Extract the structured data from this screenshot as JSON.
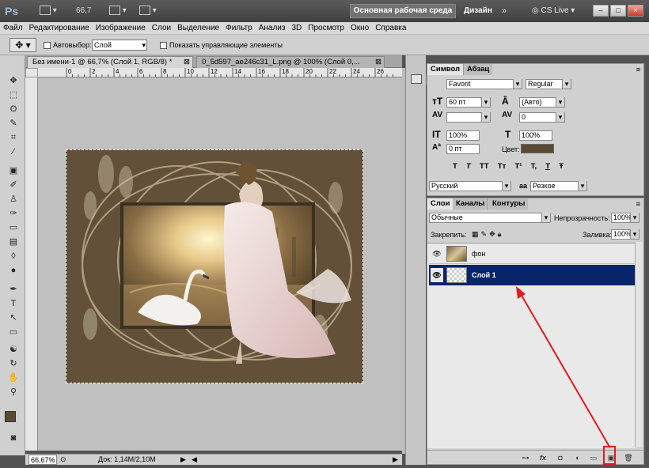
{
  "app": {
    "logo": "Ps",
    "zoom": "66,7",
    "workspace_button": "Основная рабочая среда",
    "design_label": "Дизайн",
    "more_label": "»",
    "cslive_label": "CS Live",
    "window_buttons": [
      "–",
      "□",
      "×"
    ]
  },
  "menu": [
    "Файл",
    "Редактирование",
    "Изображение",
    "Слои",
    "Выделение",
    "Фильтр",
    "Анализ",
    "3D",
    "Просмотр",
    "Окно",
    "Справка"
  ],
  "options": {
    "autoselect_label": "Автовыбор:",
    "autoselect_value": "Слой",
    "show_controls_label": "Показать управляющие элементы"
  },
  "tabs": [
    {
      "label": "Без имени-1 @ 66,7% (Слой 1, RGB/8) *",
      "active": true
    },
    {
      "label": "0_5d597_ae246c31_L.png @ 100% (Слой 0,...",
      "active": false
    }
  ],
  "ruler_numbers": [
    "0",
    "2",
    "4",
    "6",
    "8",
    "10",
    "12",
    "14",
    "16",
    "18",
    "20",
    "22",
    "24",
    "26"
  ],
  "status": {
    "zoom": "66,67%",
    "doc_info": "Док: 1,14M/2,10M"
  },
  "character": {
    "tabs": [
      "Символ",
      "Абзац"
    ],
    "font_family": "Favorit",
    "font_style": "Regular",
    "font_size": "60 пт",
    "leading": "(Авто)",
    "kerning": "",
    "tracking": "0",
    "vertical_scale": "100%",
    "horizontal_scale": "100%",
    "baseline_shift": "0 пт",
    "color_label": "Цвет:",
    "color_value": "#5a4a30",
    "style_buttons": [
      "T",
      "T",
      "TT",
      "Tт",
      "T¹",
      "T,",
      "T",
      "Ŧ"
    ],
    "language": "Русский",
    "aa_label": "aa",
    "antialias": "Резкое"
  },
  "layers": {
    "tabs": [
      "Слои",
      "Каналы",
      "Контуры"
    ],
    "blend_mode": "Обычные",
    "opacity_label": "Непрозрачность:",
    "opacity_value": "100%",
    "lock_label": "Закрепить:",
    "fill_label": "Заливка:",
    "fill_value": "100%",
    "items": [
      {
        "name": "фон",
        "selected": false,
        "icon": "eye-icon"
      },
      {
        "name": "Слой 1",
        "selected": true,
        "icon": "eye-icon"
      }
    ],
    "bottom_icons": [
      "link-icon",
      "fx-icon",
      "mask-icon",
      "adjustment-icon",
      "folder-icon",
      "new-layer-icon",
      "trash-icon"
    ]
  },
  "annotation": {
    "arrow_color": "#e21b1b"
  }
}
